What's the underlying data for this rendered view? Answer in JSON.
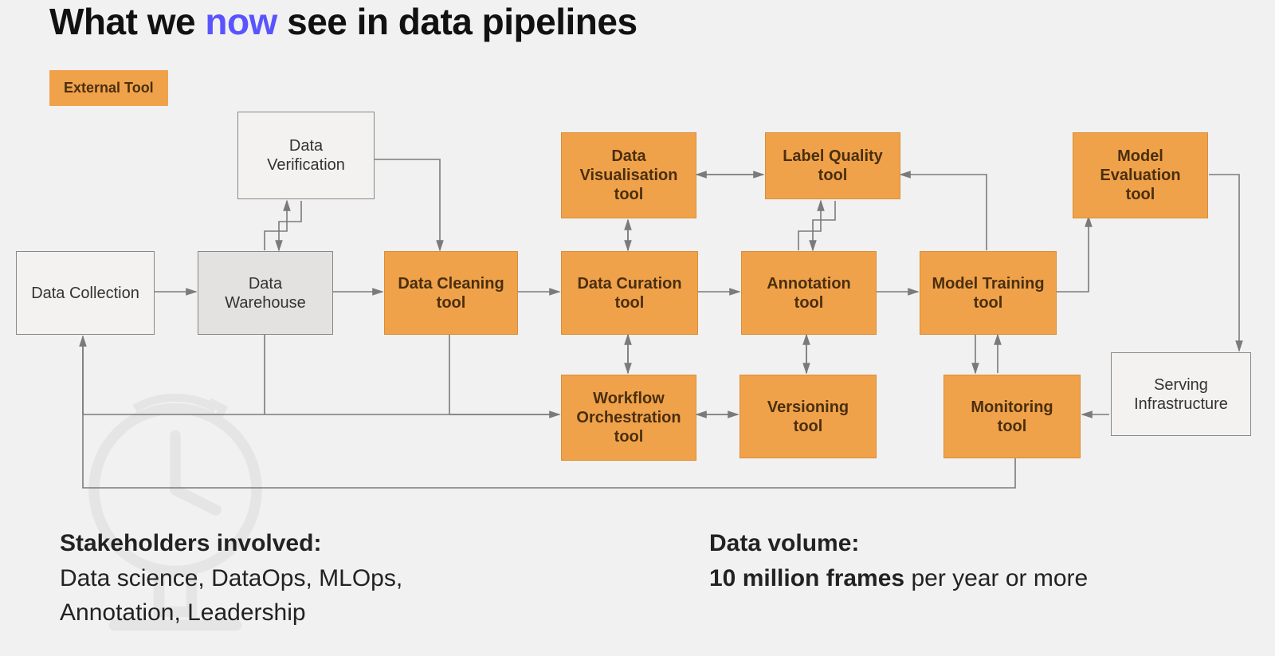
{
  "title": {
    "prefix": "What we ",
    "accent": "now",
    "suffix": " see in data pipelines"
  },
  "legend": {
    "label": "External Tool"
  },
  "nodes": {
    "data_collection": "Data Collection",
    "data_warehouse": "Data\nWarehouse",
    "data_verification": "Data\nVerification",
    "data_cleaning": "Data Cleaning\ntool",
    "data_curation": "Data Curation\ntool",
    "data_visualisation": "Data\nVisualisation\ntool",
    "workflow_orchestration": "Workflow\nOrchestration\ntool",
    "annotation": "Annotation\ntool",
    "label_quality": "Label Quality\ntool",
    "versioning": "Versioning\ntool",
    "model_training": "Model Training\ntool",
    "model_evaluation": "Model\nEvaluation\ntool",
    "monitoring": "Monitoring\ntool",
    "serving_infrastructure": "Serving\nInfrastructure"
  },
  "stakeholders": {
    "label": "Stakeholders involved:",
    "body": "Data science, DataOps, MLOps,\nAnnotation, Leadership"
  },
  "volume": {
    "label": "Data volume:",
    "emph": "10 million frames",
    "rest": " per year or more"
  },
  "colors": {
    "accent": "#5a54ff",
    "orange": "#f0a24b",
    "bg": "#f1f1f1",
    "line": "#7a7a7a"
  }
}
